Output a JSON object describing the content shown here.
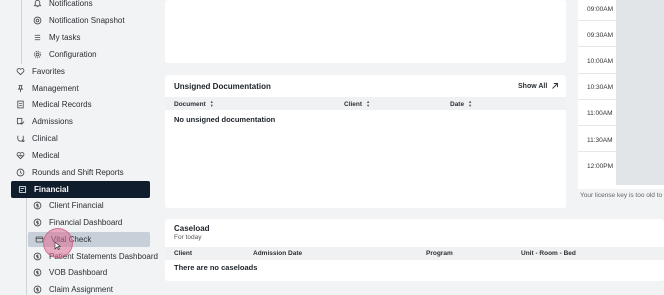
{
  "sidebar": {
    "items": [
      {
        "label": "Notifications",
        "icon": "bell-icon"
      },
      {
        "label": "Notification Snapshot",
        "icon": "target-icon"
      },
      {
        "label": "My tasks",
        "icon": "list-icon"
      },
      {
        "label": "Configuration",
        "icon": "gear-icon"
      },
      {
        "label": "Favorites",
        "icon": "heart-icon"
      },
      {
        "label": "Management",
        "icon": "pin-icon"
      },
      {
        "label": "Medical Records",
        "icon": "document-icon"
      },
      {
        "label": "Admissions",
        "icon": "admissions-icon"
      },
      {
        "label": "Clinical",
        "icon": "clinical-icon"
      },
      {
        "label": "Medical",
        "icon": "heart-pulse-icon"
      },
      {
        "label": "Rounds and Shift Reports",
        "icon": "clock-icon"
      },
      {
        "label": "Financial",
        "icon": "financial-icon"
      },
      {
        "label": "Client Financial",
        "icon": "dollar-icon"
      },
      {
        "label": "Financial Dashboard",
        "icon": "dollar-icon"
      },
      {
        "label": "Vital Check",
        "icon": "card-icon"
      },
      {
        "label": "Patient Statements Dashboard",
        "icon": "dollar-icon"
      },
      {
        "label": "VOB Dashboard",
        "icon": "dollar-icon"
      },
      {
        "label": "Claim Assignment",
        "icon": "dollar-icon"
      }
    ]
  },
  "unsigned": {
    "title": "Unsigned Documentation",
    "show_all": "Show All",
    "columns": [
      "Document",
      "Client",
      "Date"
    ],
    "empty": "No unsigned documentation"
  },
  "caseload": {
    "title": "Caseload",
    "subtitle": "For today",
    "columns": [
      "Client",
      "Admission Date",
      "Program",
      "Unit - Room - Bed"
    ],
    "empty": "There are no caseloads"
  },
  "calendar": {
    "times": [
      "09:00AM",
      "09:30AM",
      "10:00AM",
      "10:30AM",
      "11:00AM",
      "11:30AM",
      "12:00PM"
    ],
    "license_note": "Your license key is too old to w"
  },
  "colors": {
    "active_bg": "#0f1d2c",
    "highlight_bg": "#c7cfd8",
    "page_bg": "#f1f3f5"
  }
}
